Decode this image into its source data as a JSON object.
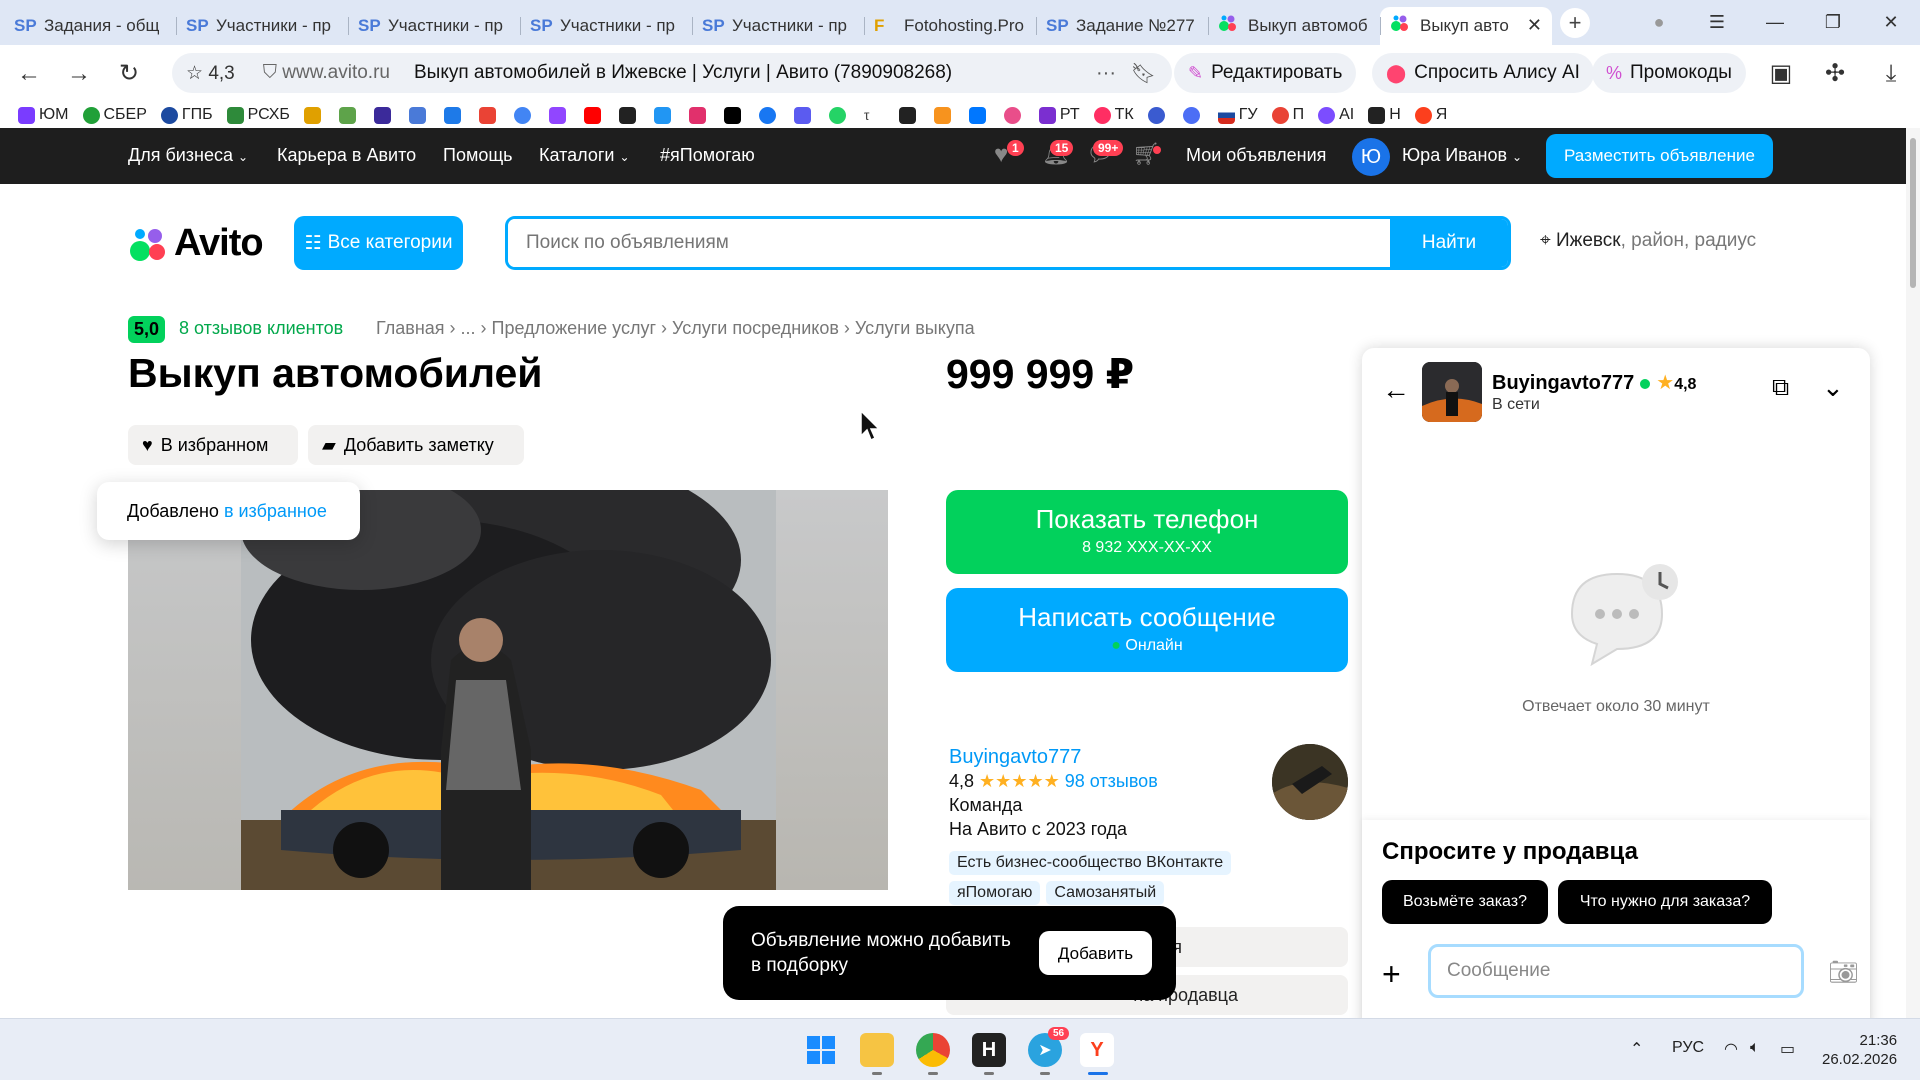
{
  "browser": {
    "tabs": [
      {
        "favicon": "SP",
        "title": "Задания - общ"
      },
      {
        "favicon": "SP",
        "title": "Участники - пр"
      },
      {
        "favicon": "SP",
        "title": "Участники - пр"
      },
      {
        "favicon": "SP",
        "title": "Участники - пр"
      },
      {
        "favicon": "SP",
        "title": "Участники - пр"
      },
      {
        "favicon": "F",
        "title": "Fotohosting.Pro"
      },
      {
        "favicon": "SP",
        "title": "Задание №277"
      },
      {
        "favicon": "avito",
        "title": "Выкуп автомоб"
      },
      {
        "favicon": "avito",
        "title": "Выкуп авто",
        "active": true
      }
    ],
    "rating": "4,3",
    "domain": "www.avito.ru",
    "page_title": "Выкуп автомобилей в Ижевске | Услуги | Авито (7890908268)",
    "pills": {
      "edit": "Редактировать",
      "alice": "Спросить Алису AI",
      "promo": "Промокоды"
    },
    "bookmarks": [
      "ЮМ",
      "СБЕР",
      "ГПБ",
      "РСХБ",
      "РТ",
      "ТК",
      "ГУ",
      "П",
      "AI",
      "Н",
      "Я"
    ]
  },
  "topnav": {
    "business": "Для бизнеса",
    "career": "Карьера в Авито",
    "help": "Помощь",
    "catalogs": "Каталоги",
    "ihelp": "#яПомогаю",
    "fav_badge": "1",
    "notif_badge": "15",
    "msg_badge": "99+",
    "my_ads": "Мои объявления",
    "avatar_letter": "Ю",
    "user": "Юра Иванов",
    "post_ad": "Разместить объявление"
  },
  "header": {
    "logo": "Avito",
    "all_categories": "Все категории",
    "search_placeholder": "Поиск по объявлениям",
    "find": "Найти",
    "city": "Ижевск",
    "location_rest": ", район, радиус"
  },
  "listing": {
    "rating": "5,0",
    "reviews_link": "8 отзывов клиентов",
    "breadcrumbs": "Главная › ... › Предложение услуг › Услуги посредников › Услуги выкупа",
    "title": "Выкуп автомобилей",
    "price": "999 999 ₽",
    "fav_button": "В избранном",
    "note_button": "Добавить заметку",
    "toast_text": "Добавлено",
    "toast_link": "в избранное",
    "show_phone": "Показать телефон",
    "phone_mask": "8 932 XXX-XX-XX",
    "write_message": "Написать сообщение",
    "online": "Онлайн"
  },
  "seller": {
    "name": "Buyingavto777",
    "rating": "4,8",
    "stars": "★★★★★",
    "reviews": "98 отзывов",
    "type": "Команда",
    "since": "На Авито с 2023 года",
    "chips": [
      "Есть бизнес-сообщество ВКонтакте",
      "яПомогаю",
      "Самозанятый"
    ],
    "btn_user_partial": "льзователя",
    "btn_seller_partial": "на продавца"
  },
  "popup": {
    "text": "Объявление можно добавить в подборку",
    "add": "Добавить"
  },
  "chat": {
    "name": "Buyingavto777",
    "rating": "4,8",
    "status": "В сети",
    "response": "Отвечает около 30 минут",
    "ask_title": "Спросите у продавца",
    "q1": "Возьмёте заказ?",
    "q2": "Что нужно для заказа?",
    "message_placeholder": "Сообщение"
  },
  "taskbar": {
    "lang": "РУС",
    "time": "21:36",
    "date": "26.02.2026",
    "telegram_badge": "56"
  },
  "colors": {
    "avito_blue": "#00aaff",
    "avito_green": "#02d15c",
    "dark_nav": "#1e1e1e"
  }
}
